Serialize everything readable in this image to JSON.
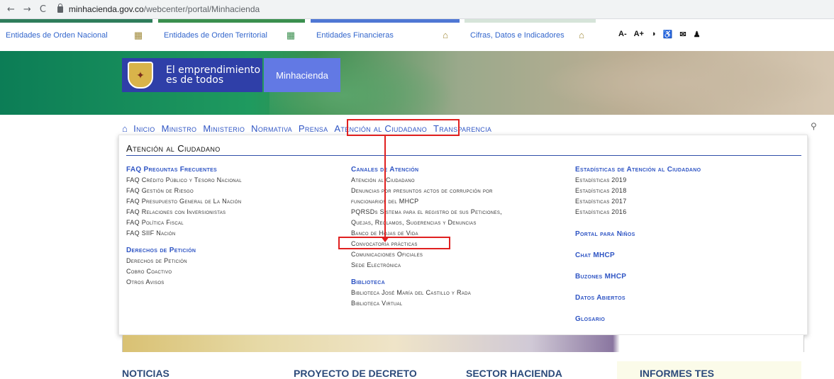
{
  "browser": {
    "back": "←",
    "forward": "→",
    "reload": "C",
    "url_domain": "minhacienda.gov.co",
    "url_path": "/webcenter/portal/Minhacienda"
  },
  "entities": [
    {
      "label": "Entidades de Orden Nacional",
      "color": "#2e7d5b"
    },
    {
      "label": "Entidades de Orden Territorial",
      "color": "#3a8f4e"
    },
    {
      "label": "Entidades Financieras",
      "color": "#4f77d4"
    },
    {
      "label": "Cifras, Datos e Indicadores",
      "color": "#d6e4d9"
    }
  ],
  "accessibility": [
    "A-",
    "A+",
    "◑",
    "♿",
    "✉",
    "♟"
  ],
  "hero": {
    "slogan_line1": "El emprendimiento",
    "slogan_line2": "es de todos",
    "ministry": "Minhacienda"
  },
  "nav": {
    "home_icon": "home-icon",
    "items": [
      "Inicio",
      "Ministro",
      "Ministerio",
      "Normativa",
      "Prensa",
      "Atención al Ciudadano",
      "Transparencia"
    ]
  },
  "panel": {
    "title": "Atención al Ciudadano",
    "col1": {
      "h1": "FAQ Preguntas Frecuentes",
      "items1": [
        "FAQ Crédito Público y Tesoro Nacional",
        "FAQ Gestión de Riesgo",
        "FAQ Presupuesto General de La Nación",
        "FAQ Relaciones con Inversionistas",
        "FAQ Política Fiscal",
        "FAQ SIIF Nación"
      ],
      "h2": "Derechos de Petición",
      "items2": [
        "Derechos de Petición",
        "Cobro Coactivo",
        "Otros Avisos"
      ]
    },
    "col2": {
      "h1": "Canales de Atención",
      "items1": [
        "Atención al Ciudadano",
        "Denuncias por presuntos actos de corrupción por",
        "funcionarios del MHCP",
        "PQRSDs Sistema para el registro de sus Peticiones,",
        "Quejas, Reclamos, Sugerencias y Denuncias",
        "Banco de Hojas de Vida",
        "Convocatoria prácticas",
        "Comunicaciones Oficiales",
        "Sede Electrónica"
      ],
      "h2": "Biblioteca",
      "items2": [
        "Biblioteca José María del Castillo y Rada",
        "Biblioteca Virtual"
      ]
    },
    "col3": {
      "h1": "Estadísticas de Atención al Ciudadano",
      "items1": [
        "Estadísticas 2019",
        "Estadísticas 2018",
        "Estadísticas 2017",
        "Estadísticas 2016"
      ],
      "links": [
        "Portal para Niños",
        "Chat MHCP",
        "Buzones MHCP",
        "Datos Abiertos",
        "Glosario"
      ]
    }
  },
  "bottom": [
    "NOTICIAS",
    "PROYECTO DE DECRETO",
    "SECTOR HACIENDA",
    "INFORMES TES"
  ]
}
